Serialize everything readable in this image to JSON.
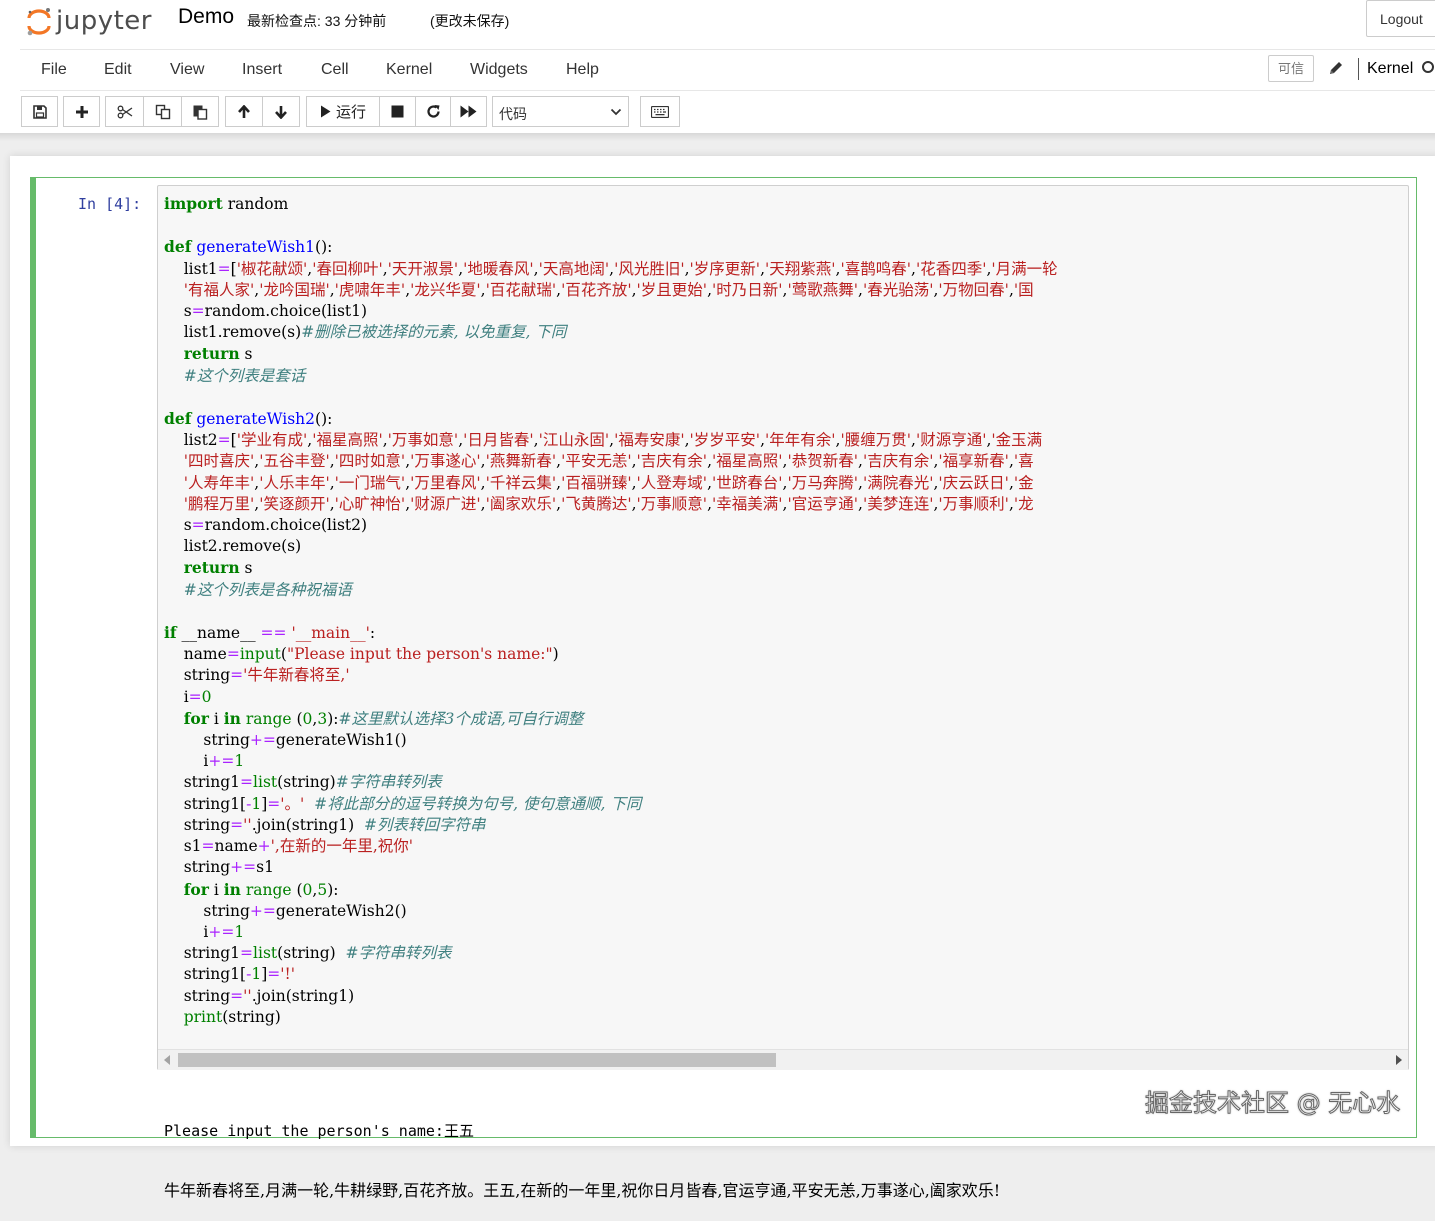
{
  "header": {
    "logo_text": "jupyter",
    "notebook_name": "Demo",
    "checkpoint": "最新检查点: 33 分钟前",
    "autosave_status": "(更改未保存)",
    "logout_label": "Logout"
  },
  "menubar": {
    "items": [
      "File",
      "Edit",
      "View",
      "Insert",
      "Cell",
      "Kernel",
      "Widgets",
      "Help"
    ],
    "trusted_label": "可信",
    "kernel_label": "Kernel"
  },
  "toolbar": {
    "run_label": "运行",
    "cell_type": "代码"
  },
  "cell": {
    "prompt": "In  [4]:",
    "output_lines": [
      "Please input the person's name:王五",
      "牛年新春将至,月满一轮,牛耕绿野,百花齐放。王五,在新的一年里,祝你日月皆春,官运亨通,平安无恙,万事遂心,阖家欢乐!"
    ]
  },
  "code_lines": [
    "import random",
    "",
    "def generateWish1():",
    "    list1=['椒花献颂','春回柳叶','天开淑景','地暖春风','天高地阔','风光胜旧','岁序更新','天翔紫燕','喜鹊鸣春','花香四季','月满一轮",
    "    '有福人家','龙吟国瑞','虎啸年丰','龙兴华夏','百花献瑞','百花齐放','岁且更始','时乃日新','莺歌燕舞','春光骀荡','万物回春','国",
    "    s=random.choice(list1)",
    "    list1.remove(s)#删除已被选择的元素, 以免重复, 下同",
    "    return s",
    "    #这个列表是套话",
    "",
    "def generateWish2():",
    "    list2=['学业有成','福星高照','万事如意','日月皆春','江山永固','福寿安康','岁岁平安','年年有余','腰缠万贯','财源亨通','金玉满",
    "    '四时喜庆','五谷丰登','四时如意','万事遂心','燕舞新春','平安无恙','吉庆有余','福星高照','恭贺新春','吉庆有余','福享新春','喜",
    "    '人寿年丰','人乐丰年','一门瑞气','万里春风','千祥云集','百福骈臻','人登寿域','世跻春台','万马奔腾','满院春光','庆云跃日','金",
    "    '鹏程万里','笑逐颜开','心旷神怡','财源广进','阖家欢乐','飞黄腾达','万事顺意','幸福美满','官运亨通','美梦连连','万事顺利','龙",
    "    s=random.choice(list2)",
    "    list2.remove(s)",
    "    return s",
    "    #这个列表是各种祝福语",
    "",
    "if __name__ == '__main__':",
    "    name=input(\"Please input the person's name:\")",
    "    string='牛年新春将至,'",
    "    i=0",
    "    for i in range (0,3):#这里默认选择3个成语,可自行调整",
    "        string+=generateWish1()",
    "        i+=1",
    "    string1=list(string)#字符串转列表",
    "    string1[-1]='。'  #将此部分的逗号转换为句号, 使句意通顺, 下同",
    "    string=''.join(string1)  #列表转回字符串",
    "    s1=name+',在新的一年里,祝你'",
    "    string+=s1",
    "    for i in range (0,5):",
    "        string+=generateWish2()",
    "        i+=1",
    "    string1=list(string)  #字符串转列表",
    "    string1[-1]='!'",
    "    string=''.join(string1)",
    "    print(string)"
  ],
  "watermark": "掘金技术社区 @ 无心水"
}
